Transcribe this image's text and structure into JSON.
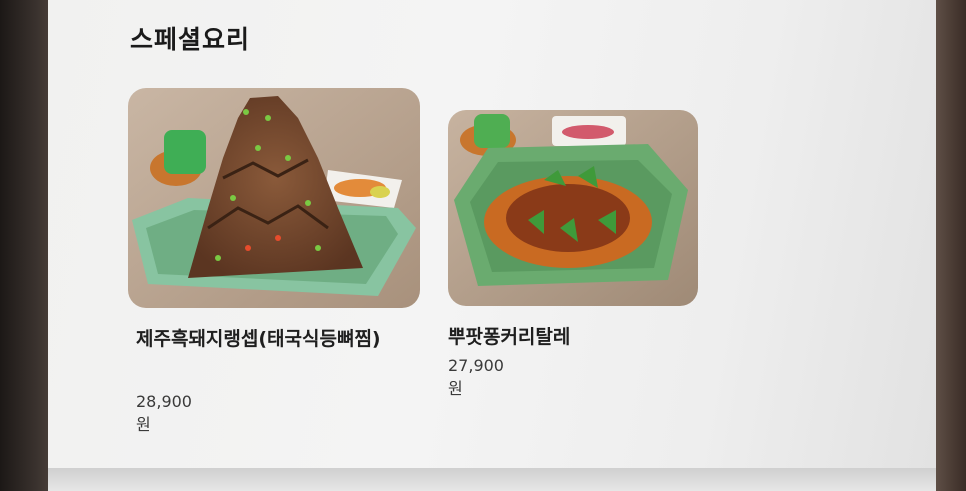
{
  "section": {
    "title": "스페셜요리"
  },
  "menu_items": [
    {
      "name": "제주흑돼지랭셉(태국식등뼈찜)",
      "price": "28,900원"
    },
    {
      "name": "뿌팟퐁커리탈레",
      "price": "27,900원"
    }
  ],
  "colors": {
    "background": "#f3f3f3",
    "text": "#1f1f1f",
    "plate_green": "#7fb88a"
  }
}
